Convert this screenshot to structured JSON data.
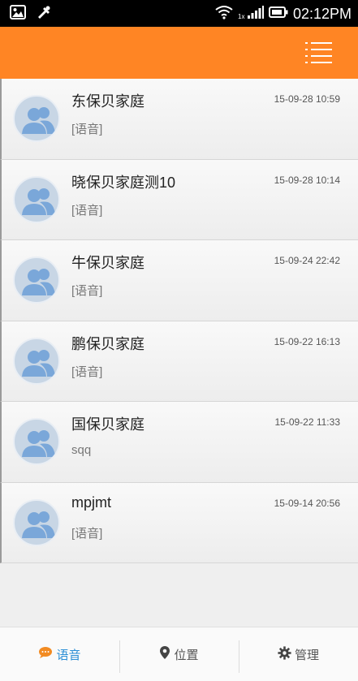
{
  "status_bar": {
    "time": "02:12PM",
    "icons": [
      "image-icon",
      "tools-icon",
      "wifi-icon",
      "signal-icon",
      "battery-icon"
    ]
  },
  "app_bar": {
    "menu_icon": "list-menu-icon",
    "color": "#ff8524"
  },
  "conversations": [
    {
      "name": "东保贝家庭",
      "time": "15-09-28 10:59",
      "preview": "[语音]"
    },
    {
      "name": "晓保贝家庭测10",
      "time": "15-09-28 10:14",
      "preview": "[语音]"
    },
    {
      "name": "牛保贝家庭",
      "time": "15-09-24 22:42",
      "preview": "[语音]"
    },
    {
      "name": "鹏保贝家庭",
      "time": "15-09-22 16:13",
      "preview": "[语音]"
    },
    {
      "name": "国保贝家庭",
      "time": "15-09-22 11:33",
      "preview": "sqq"
    },
    {
      "name": "mpjmt",
      "time": "15-09-14 20:56",
      "preview": "[语音]"
    }
  ],
  "tabs": [
    {
      "label": "语音",
      "icon": "chat-bubble-icon",
      "active": true
    },
    {
      "label": "位置",
      "icon": "location-pin-icon",
      "active": false
    },
    {
      "label": "管理",
      "icon": "gear-icon",
      "active": false
    }
  ],
  "colors": {
    "accent": "#ff8524",
    "active_tab": "#2b8fd6"
  }
}
